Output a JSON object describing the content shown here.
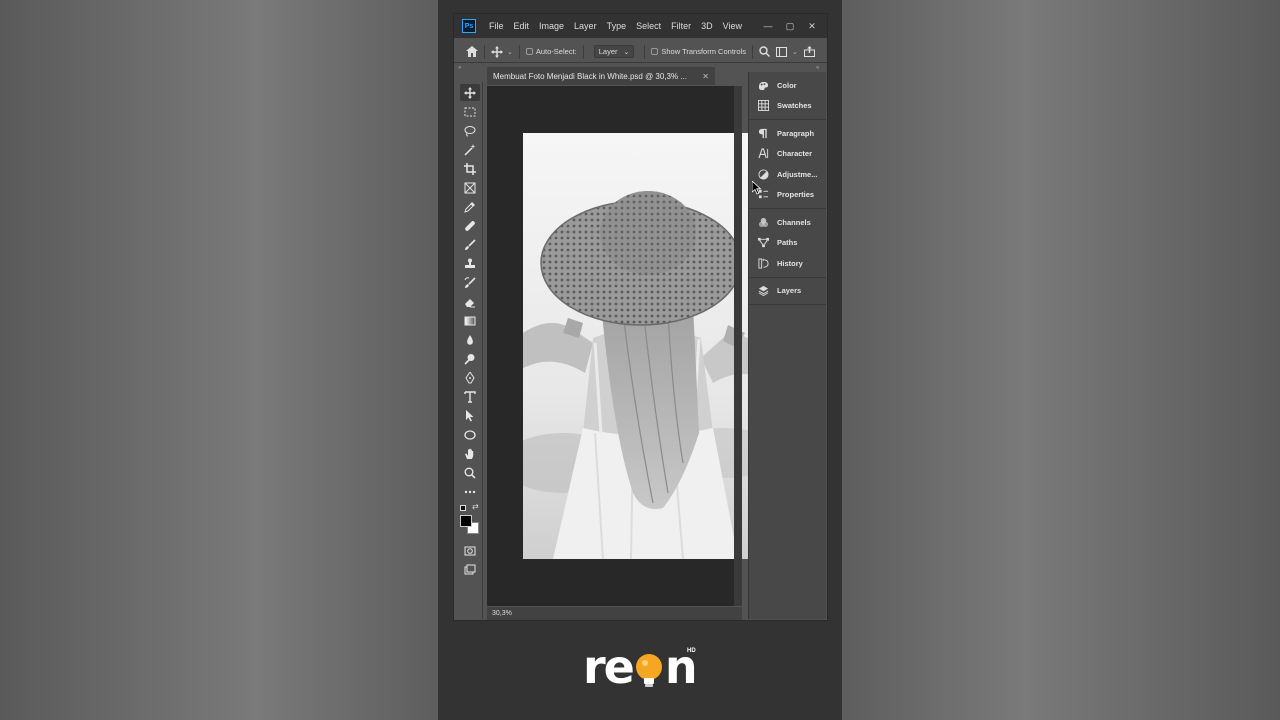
{
  "app": {
    "logo_text": "Ps",
    "menu": [
      "File",
      "Edit",
      "Image",
      "Layer",
      "Type",
      "Select",
      "Filter",
      "3D",
      "View"
    ],
    "window_controls": {
      "minimize": "—",
      "maximize": "▢",
      "close": "✕"
    }
  },
  "options": {
    "auto_select_label": "Auto-Select:",
    "layer_select_value": "Layer",
    "transform_label": "Show Transform Controls"
  },
  "document": {
    "tab_title": "Membuat Foto Menjadi Black in White.psd @ 30,3% ...",
    "zoom_status": "30,3%"
  },
  "panels": [
    {
      "group": [
        {
          "name": "Color",
          "icon": "color-wheel-icon"
        },
        {
          "name": "Swatches",
          "icon": "grid-icon"
        }
      ]
    },
    {
      "group": [
        {
          "name": "Paragraph",
          "icon": "pilcrow-icon"
        },
        {
          "name": "Character",
          "icon": "character-icon"
        },
        {
          "name": "Adjustme...",
          "icon": "adjustments-icon"
        },
        {
          "name": "Properties",
          "icon": "properties-icon"
        }
      ]
    },
    {
      "group": [
        {
          "name": "Channels",
          "icon": "channels-icon"
        },
        {
          "name": "Paths",
          "icon": "paths-icon"
        },
        {
          "name": "History",
          "icon": "history-icon"
        }
      ]
    },
    {
      "group": [
        {
          "name": "Layers",
          "icon": "layers-icon"
        }
      ]
    }
  ],
  "branding": {
    "logo_left": "re",
    "logo_right": "n",
    "logo_badge": "HD",
    "accent_color": "#f5a623"
  }
}
